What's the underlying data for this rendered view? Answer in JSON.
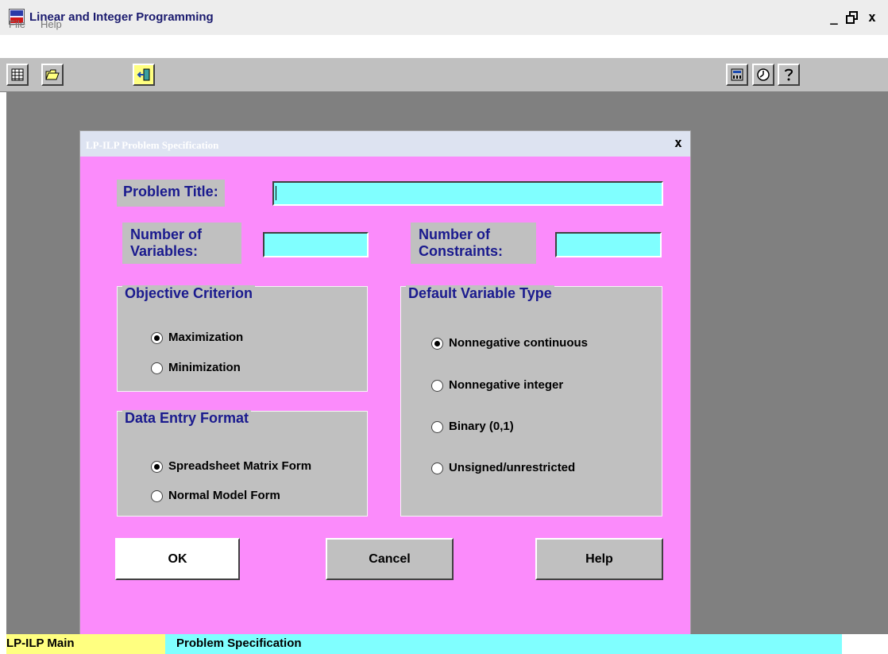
{
  "window": {
    "title": "Linear and Integer Programming",
    "controls": {
      "minimize": "_",
      "restore": "🗗",
      "close": "x"
    }
  },
  "menu": {
    "items": [
      {
        "label": "File"
      },
      {
        "label": "Help"
      }
    ]
  },
  "toolbar": {
    "left_icons": [
      "spreadsheet-icon",
      "open-folder-icon",
      "exit-door-icon"
    ],
    "right_icons": [
      "calculator-icon",
      "clock-icon",
      "help-question-icon"
    ]
  },
  "dialog": {
    "title": "LP-ILP Problem Specification",
    "close_glyph": "x",
    "problem_title": {
      "label": "Problem Title:",
      "value": ""
    },
    "num_variables": {
      "label_line1": "Number of",
      "label_line2": "Variables:",
      "value": ""
    },
    "num_constraints": {
      "label_line1": "Number of",
      "label_line2": "Constraints:",
      "value": ""
    },
    "objective": {
      "title": "Objective Criterion",
      "options": [
        {
          "label": "Maximization",
          "selected": true
        },
        {
          "label": "Minimization",
          "selected": false
        }
      ]
    },
    "data_entry": {
      "title": "Data Entry Format",
      "options": [
        {
          "label": "Spreadsheet Matrix Form",
          "selected": true
        },
        {
          "label": "Normal Model Form",
          "selected": false
        }
      ]
    },
    "var_type": {
      "title": "Default Variable Type",
      "options": [
        {
          "label": "Nonnegative continuous",
          "selected": true
        },
        {
          "label": "Nonnegative integer",
          "selected": false
        },
        {
          "label": "Binary (0,1)",
          "selected": false
        },
        {
          "label": "Unsigned/unrestricted",
          "selected": false
        }
      ]
    },
    "buttons": {
      "ok": "OK",
      "cancel": "Cancel",
      "help": "Help"
    }
  },
  "status": {
    "left": "LP-ILP Main",
    "right": "Problem Specification"
  },
  "colors": {
    "dialog_bg": "#fb8bfb",
    "field_bg": "#80ffff",
    "label_text": "#1a1a8e",
    "workspace": "#808080",
    "status_left": "#ffff80",
    "status_right": "#80ffff"
  }
}
